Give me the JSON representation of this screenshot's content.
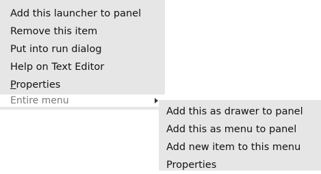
{
  "context_menu": {
    "items": [
      {
        "label": "Add this launcher to panel"
      },
      {
        "label": "Remove this item"
      },
      {
        "label": "Put into run dialog"
      },
      {
        "label": "Help on Text Editor"
      },
      {
        "label_mnemonic": "P",
        "label_rest": "roperties"
      },
      {
        "label": "Entire menu",
        "submenu_icon": "submenu-arrow-icon"
      }
    ]
  },
  "submenu": {
    "items": [
      {
        "label": "Add this as drawer to panel"
      },
      {
        "label": "Add this as menu to panel"
      },
      {
        "label": "Add new item to this menu"
      },
      {
        "label": "Properties"
      }
    ]
  }
}
